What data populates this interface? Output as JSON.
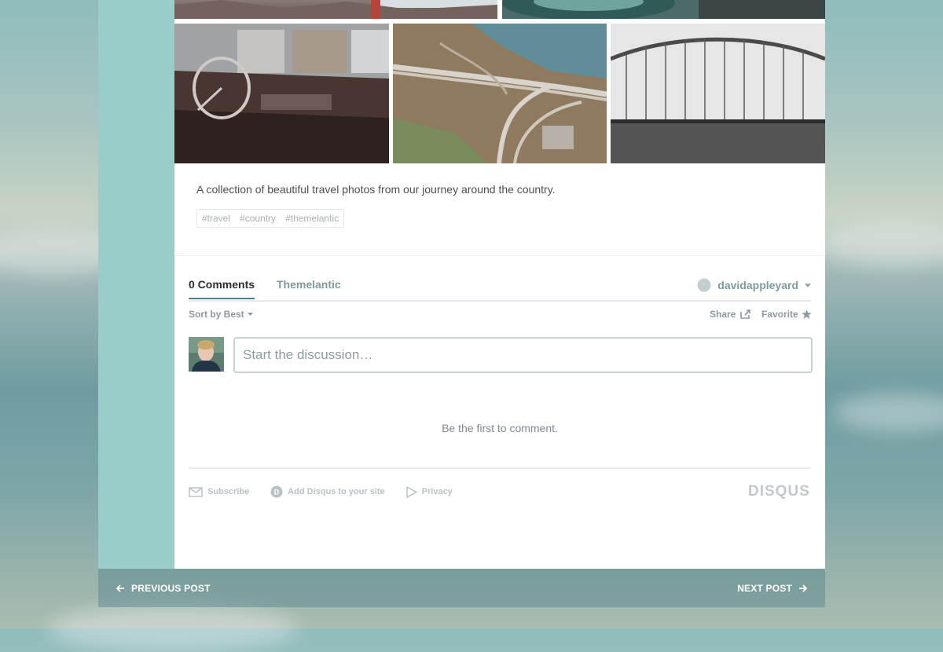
{
  "post": {
    "description": "A collection of beautiful travel photos from our journey around the country.",
    "tags": [
      "#travel",
      "#country",
      "#themelantic"
    ]
  },
  "gallery": {
    "photos": [
      {
        "name": "mountain-bridge-photo"
      },
      {
        "name": "vintage-car-photo"
      },
      {
        "name": "car-interior-photo"
      },
      {
        "name": "highway-aerial-photo"
      },
      {
        "name": "arch-bridge-photo"
      }
    ]
  },
  "comments": {
    "tabs": [
      "0 Comments",
      "Themelantic"
    ],
    "username": "davidappleyard",
    "sort_label": "Sort by Best",
    "share_label": "Share",
    "favorite_label": "Favorite",
    "placeholder": "Start the discussion…",
    "empty_message": "Be the first to comment.",
    "footer_links": [
      "Subscribe",
      "Add Disqus to your site",
      "Privacy"
    ],
    "brand": "DISQUS"
  },
  "navigation": {
    "previous_label": "PREVIOUS POST",
    "next_label": "NEXT POST"
  },
  "colors": {
    "accent": "#4f7f86",
    "side_panel": "#98cdca",
    "muted_text": "#7c9aa1"
  }
}
